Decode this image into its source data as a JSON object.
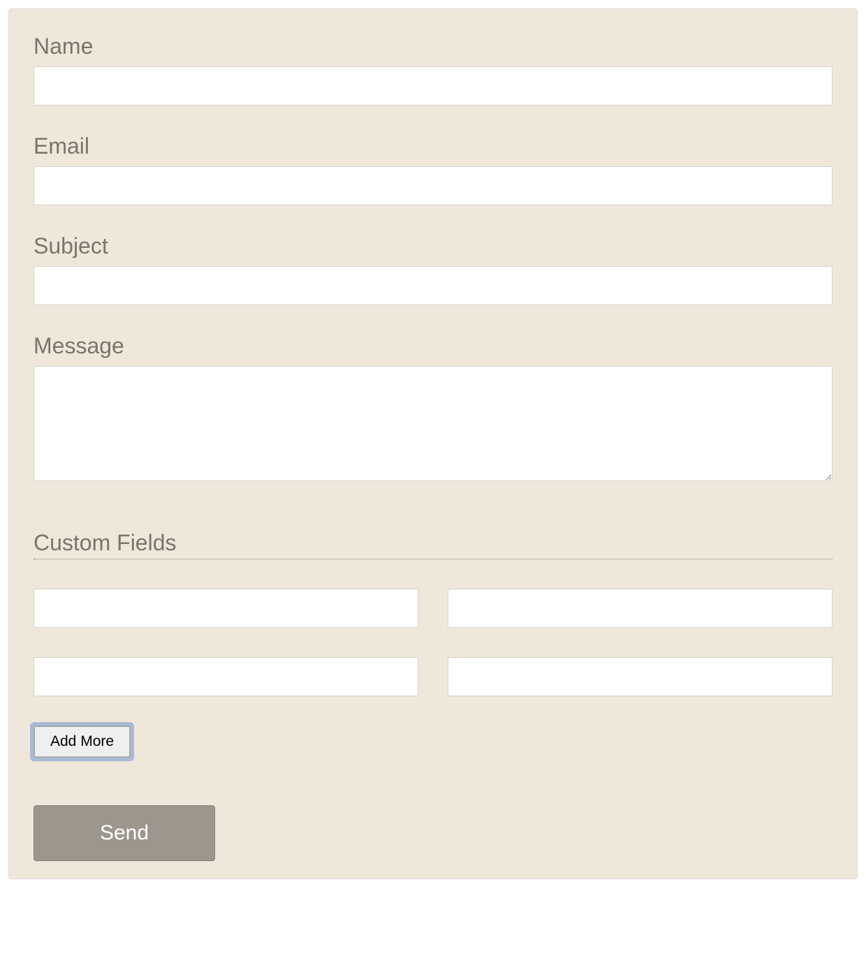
{
  "fields": {
    "name": {
      "label": "Name",
      "value": ""
    },
    "email": {
      "label": "Email",
      "value": ""
    },
    "subject": {
      "label": "Subject",
      "value": ""
    },
    "message": {
      "label": "Message",
      "value": ""
    }
  },
  "customFields": {
    "title": "Custom Fields",
    "rows": [
      {
        "left": "",
        "right": ""
      },
      {
        "left": "",
        "right": ""
      }
    ]
  },
  "buttons": {
    "addMore": "Add More",
    "send": "Send"
  }
}
